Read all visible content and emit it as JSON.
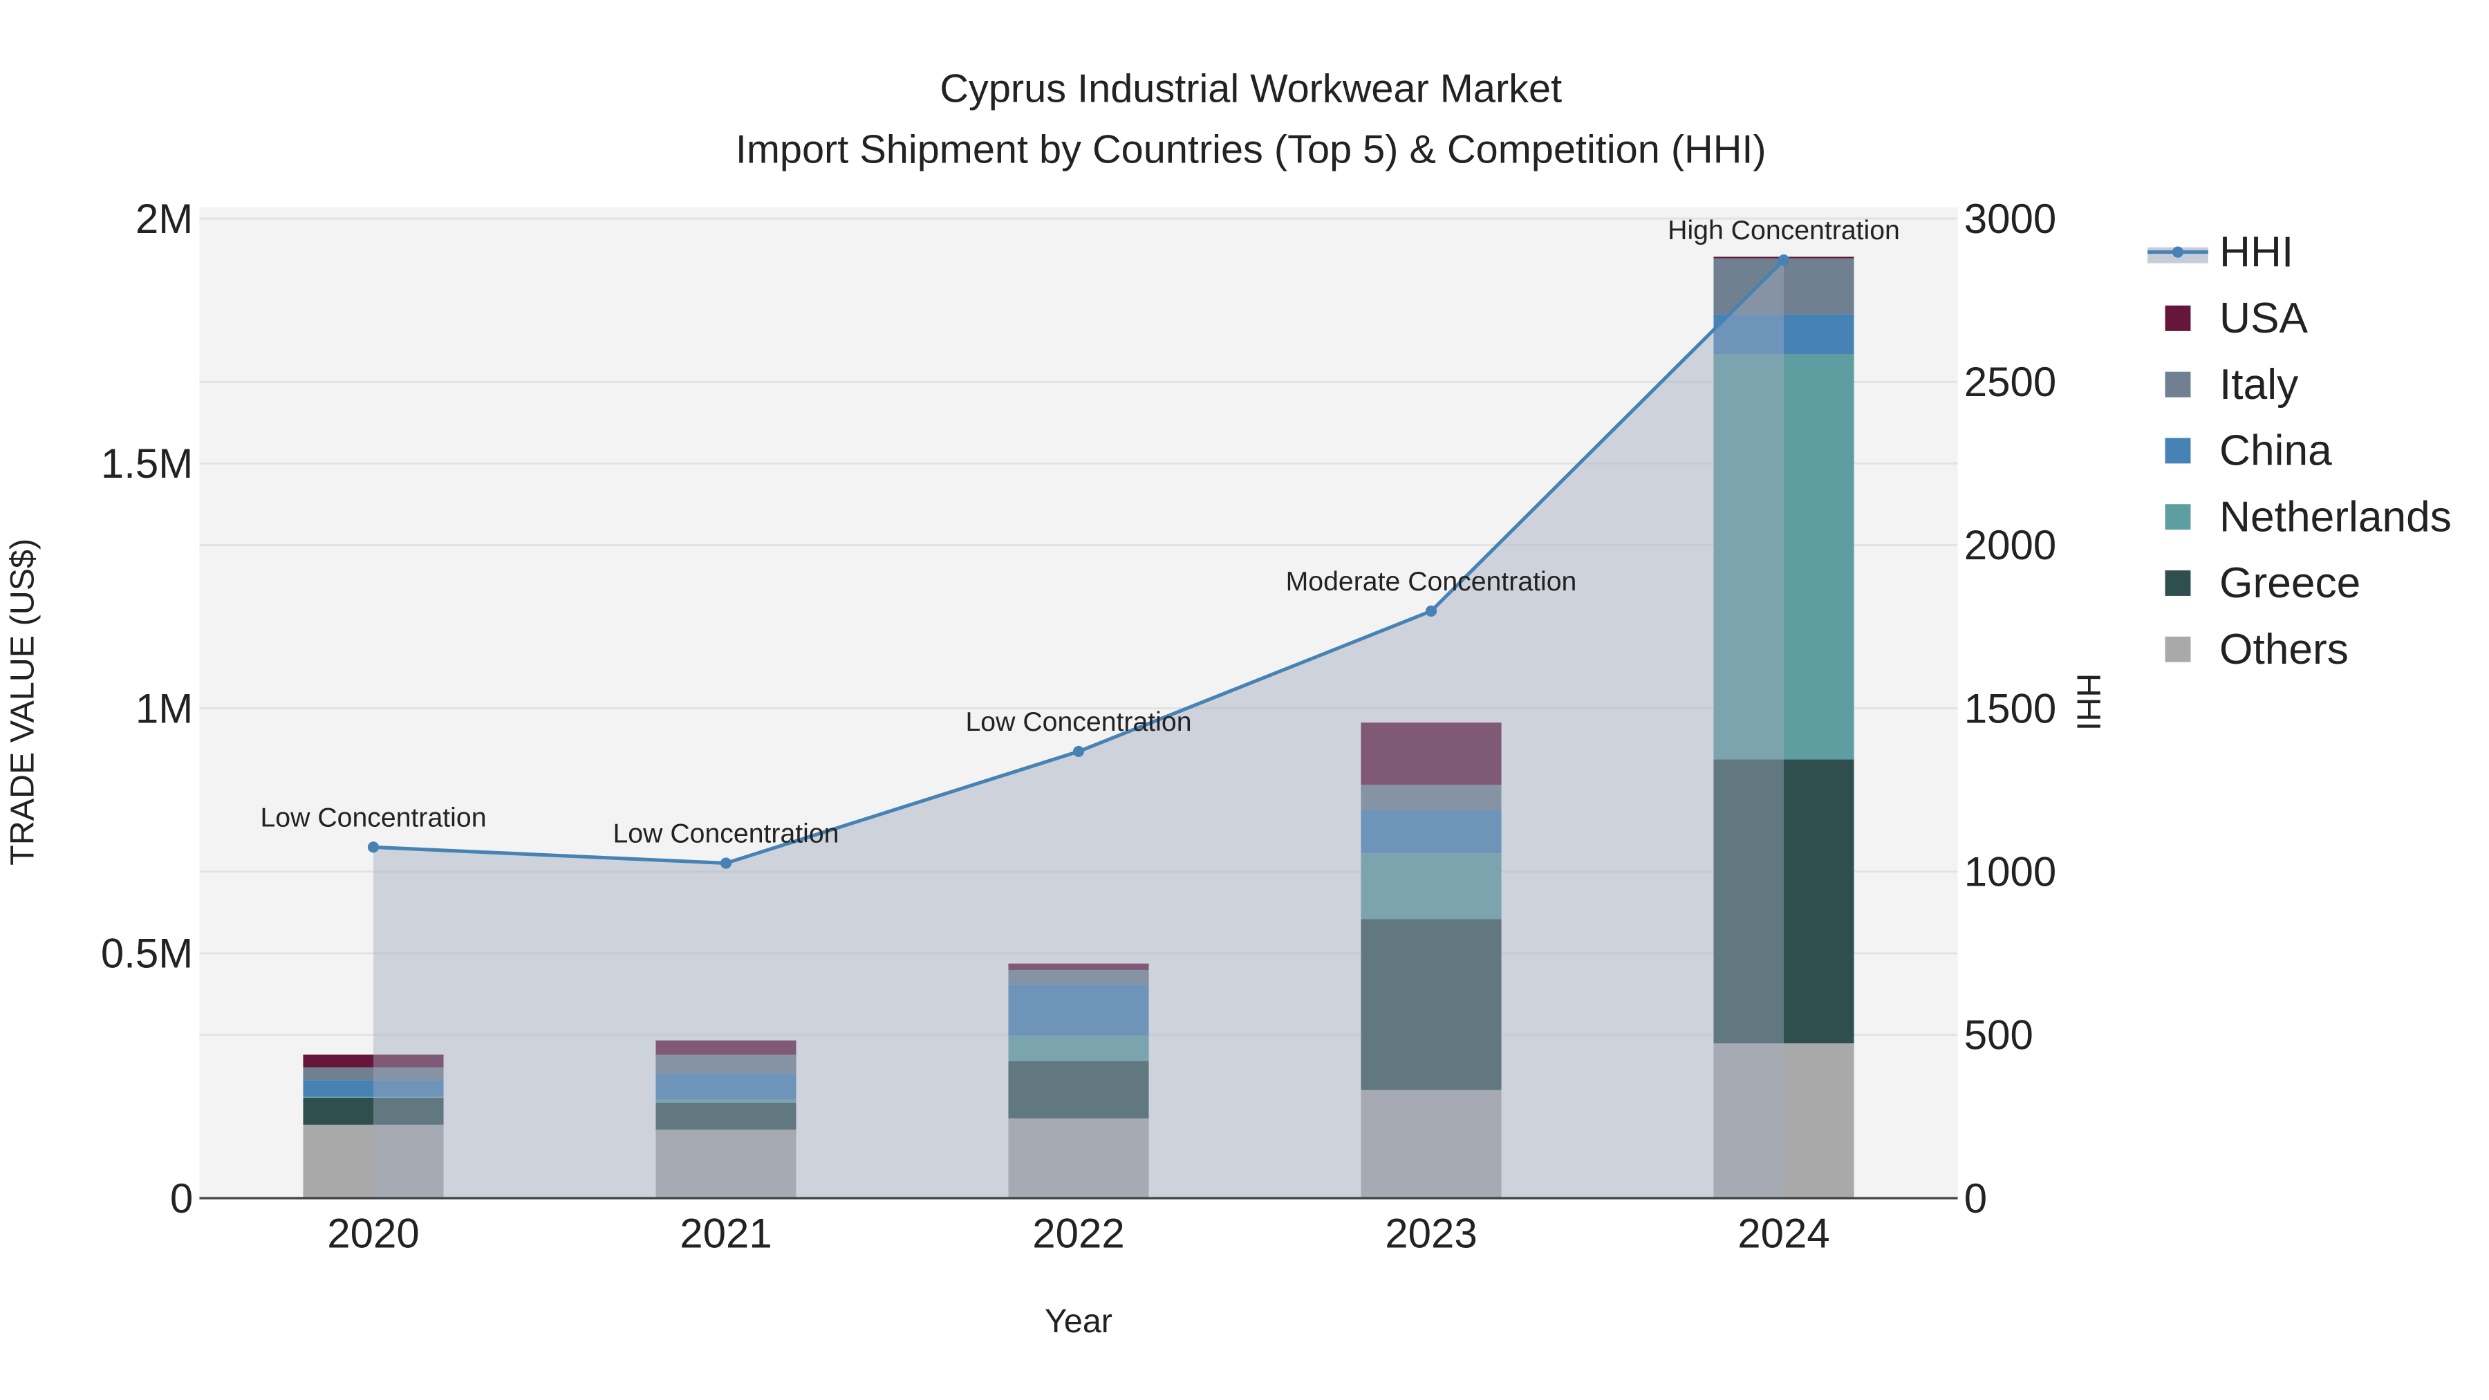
{
  "chart_data": {
    "type": "bar",
    "title": "Cyprus Industrial Workwear Market",
    "subtitle": "Import Shipment by Countries (Top 5) & Competition (HHI)",
    "xlabel": "Year",
    "ylabel": "TRADE VALUE (US$)",
    "y2label": "HHI",
    "categories": [
      "2020",
      "2021",
      "2022",
      "2023",
      "2024"
    ],
    "ylim": [
      0,
      2000000
    ],
    "y2lim": [
      0,
      3000
    ],
    "yticks": [
      {
        "v": 0,
        "label": "0"
      },
      {
        "v": 500000,
        "label": "0.5M"
      },
      {
        "v": 1000000,
        "label": "1M"
      },
      {
        "v": 1500000,
        "label": "1.5M"
      },
      {
        "v": 2000000,
        "label": "2M"
      }
    ],
    "y2ticks": [
      {
        "v": 0,
        "label": "0"
      },
      {
        "v": 500,
        "label": "500"
      },
      {
        "v": 1000,
        "label": "1000"
      },
      {
        "v": 1500,
        "label": "1500"
      },
      {
        "v": 2000,
        "label": "2000"
      },
      {
        "v": 2500,
        "label": "2500"
      },
      {
        "v": 3000,
        "label": "3000"
      }
    ],
    "stack_order": [
      "Others",
      "Greece",
      "Netherlands",
      "China",
      "Italy",
      "USA"
    ],
    "series": [
      {
        "name": "USA",
        "color": "#65163a",
        "values": [
          26000,
          29000,
          13000,
          127000,
          3000
        ]
      },
      {
        "name": "Italy",
        "color": "#708090",
        "values": [
          26000,
          39000,
          30000,
          52000,
          114000
        ]
      },
      {
        "name": "China",
        "color": "#4682b4",
        "values": [
          34000,
          52000,
          104000,
          88000,
          82000
        ]
      },
      {
        "name": "Netherlands",
        "color": "#5f9ea0",
        "values": [
          2000,
          7000,
          52000,
          134000,
          827000
        ]
      },
      {
        "name": "Greece",
        "color": "#2f4f4f",
        "values": [
          55000,
          55000,
          117000,
          349000,
          580000
        ]
      },
      {
        "name": "Others",
        "color": "#a9a9a9",
        "values": [
          150000,
          140000,
          163000,
          221000,
          316000
        ]
      }
    ],
    "line": {
      "name": "HHI",
      "color": "#4682b4",
      "axis": "right",
      "values": [
        1075,
        1026,
        1368,
        1798,
        2873
      ],
      "annotations": [
        "Low Concentration",
        "Low Concentration",
        "Low Concentration",
        "Moderate Concentration",
        "High Concentration"
      ]
    },
    "legend": [
      "HHI",
      "USA",
      "Italy",
      "China",
      "Netherlands",
      "Greece",
      "Others"
    ],
    "legend_position": "right",
    "grid": true
  }
}
